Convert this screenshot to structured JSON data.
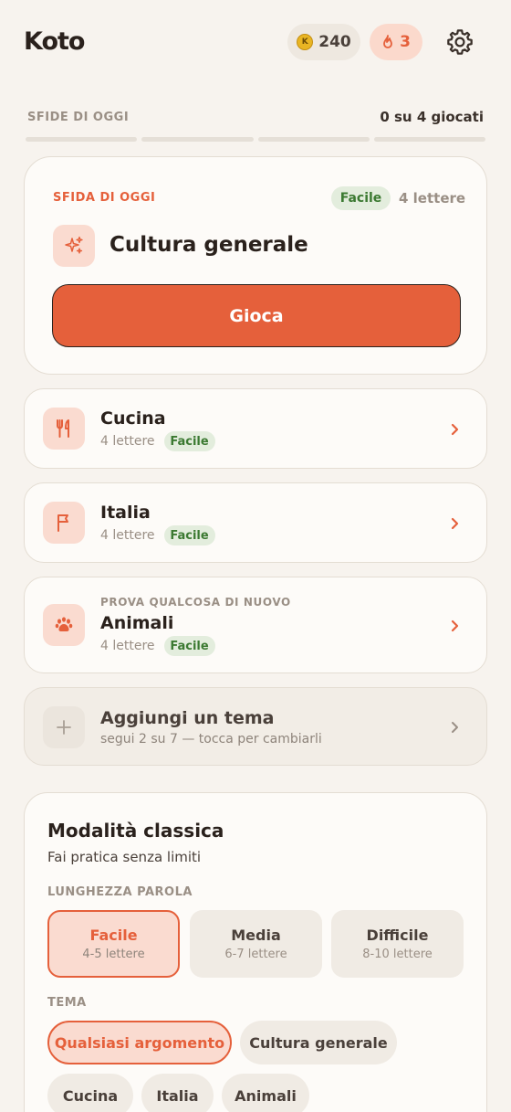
{
  "header": {
    "logo": "Koto",
    "coins": "240",
    "coin_symbol": "K",
    "streak": "3"
  },
  "challenges": {
    "label": "SFIDE DI OGGI",
    "count": "0 su 4 giocati",
    "total": 4,
    "completed": 0
  },
  "daily": {
    "tag": "SFIDA DI OGGI",
    "difficulty": "Facile",
    "length": "4 lettere",
    "title": "Cultura generale",
    "play_label": "Gioca"
  },
  "topics": [
    {
      "name": "Cucina",
      "length": "4 lettere",
      "difficulty": "Facile",
      "icon": "fork-knife-icon"
    },
    {
      "name": "Italia",
      "length": "4 lettere",
      "difficulty": "Facile",
      "icon": "flag-icon"
    },
    {
      "kicker": "PROVA QUALCOSA DI NUOVO",
      "name": "Animali",
      "length": "4 lettere",
      "difficulty": "Facile",
      "icon": "paw-icon"
    }
  ],
  "add_topic": {
    "title": "Aggiungi un tema",
    "subtitle": "segui 2 su 7 — tocca per cambiarli"
  },
  "classic": {
    "title": "Modalità classica",
    "subtitle": "Fai pratica senza limiti",
    "length_label": "LUNGHEZZA PAROLA",
    "lengths": [
      {
        "label": "Facile",
        "desc": "4-5 lettere"
      },
      {
        "label": "Media",
        "desc": "6-7 lettere"
      },
      {
        "label": "Difficile",
        "desc": "8-10 lettere"
      }
    ],
    "theme_label": "TEMA",
    "themes": [
      "Qualsiasi argomento",
      "Cultura generale",
      "Cucina",
      "Italia",
      "Animali"
    ]
  },
  "colors": {
    "accent": "#e5603b",
    "background": "#f7f3ee",
    "easy_badge": "#e3eddd"
  }
}
